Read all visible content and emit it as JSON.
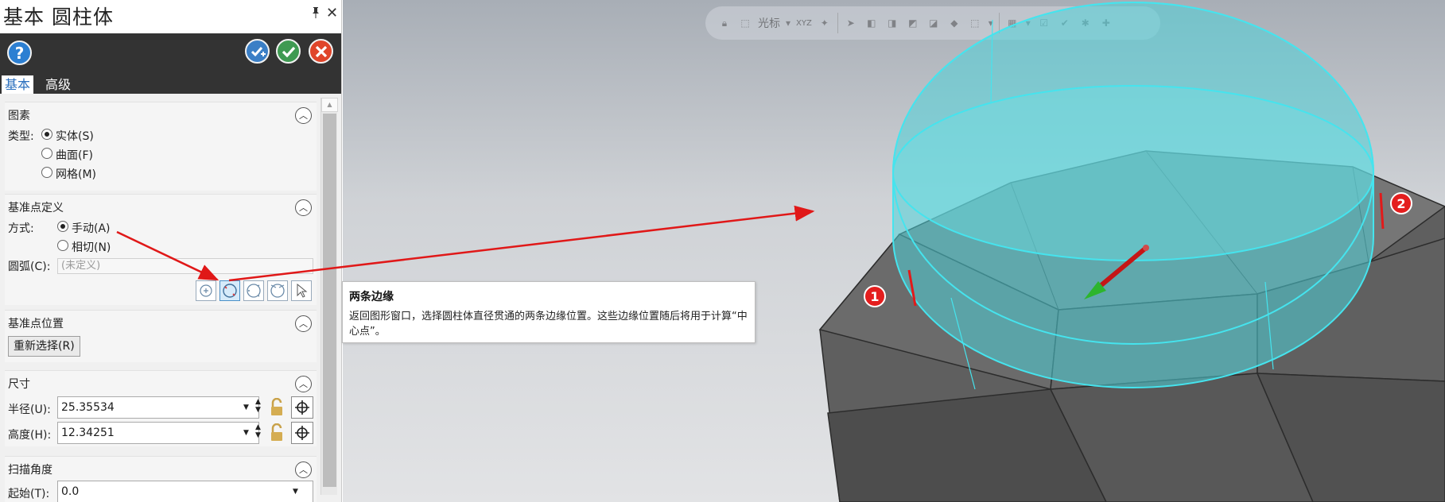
{
  "panel": {
    "title": "基本 圆柱体",
    "pin_icon": "pin-icon",
    "close_icon": "close-icon",
    "help_label": "?",
    "tabs": [
      {
        "label": "基本"
      },
      {
        "label": "高级"
      }
    ]
  },
  "sections": {
    "elements": {
      "title": "图素",
      "type_label": "类型:",
      "options": [
        "实体(S)",
        "曲面(F)",
        "网格(M)"
      ],
      "selected": "实体(S)"
    },
    "base_point_def": {
      "title": "基准点定义",
      "method_label": "方式:",
      "options": [
        "手动(A)",
        "相切(N)"
      ],
      "selected": "手动(A)",
      "arc_label": "圆弧(C):",
      "arc_placeholder": "(未定义)"
    },
    "base_point_pos": {
      "title": "基准点位置",
      "reselect_label": "重新选择(R)"
    },
    "dimensions": {
      "title": "尺寸",
      "radius_label": "半径(U):",
      "radius_value": "25.35534",
      "height_label": "高度(H):",
      "height_value": "12.34251"
    },
    "sweep": {
      "title": "扫描角度",
      "start_label": "起始(T):",
      "start_value": "0.0"
    }
  },
  "viewport": {
    "toolbar_cursor_label": "光标",
    "toolbar_xyz_label": "XYZ"
  },
  "tooltip": {
    "title": "两条边缘",
    "body": "返回图形窗口，选择圆柱体直径贯通的两条边缘位置。这些边缘位置随后将用于计算“中心点”。"
  },
  "markers": [
    "1",
    "2"
  ],
  "colors": {
    "accent": "#2a6fbe",
    "dark_bar": "#333333",
    "cylinder": "#4fd1d8",
    "arrow": "#e01818",
    "marker": "#e41e1e"
  }
}
